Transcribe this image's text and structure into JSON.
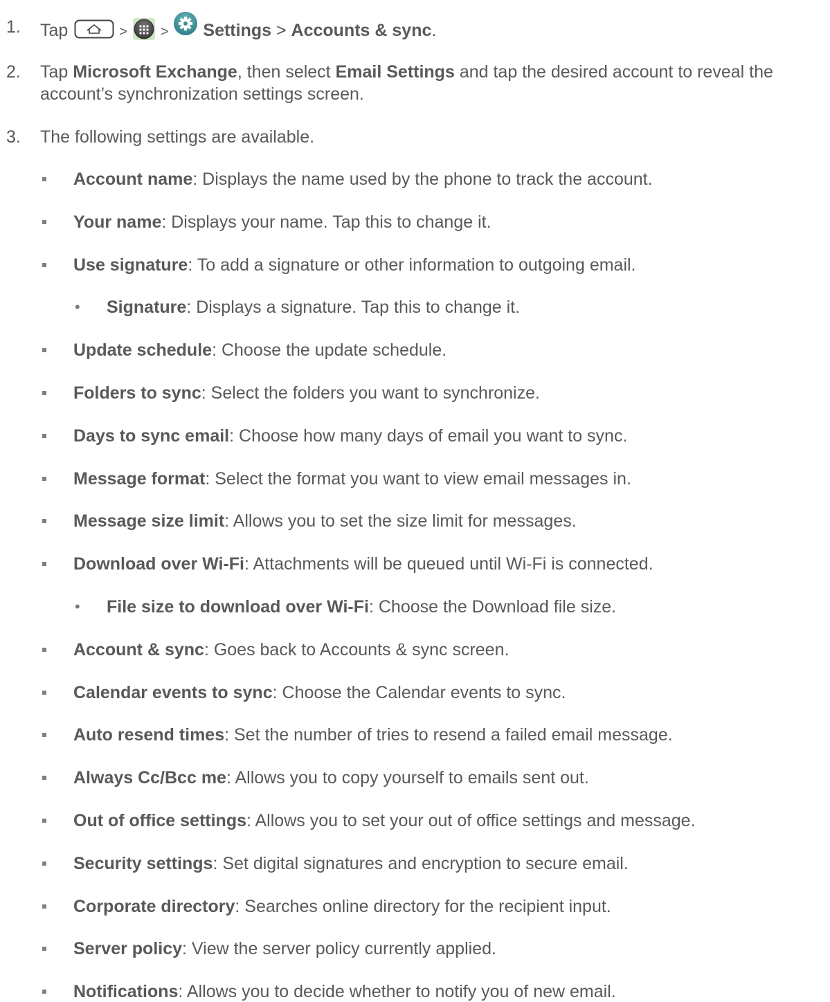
{
  "step1": {
    "number": "1.",
    "tap": "Tap",
    "sep1": ">",
    "sep2": ">",
    "settings": "Settings",
    "sep3": ">",
    "accounts_sync": "Accounts & sync",
    "end": ".",
    "icons": [
      "home-key-icon",
      "apps-icon",
      "settings-gear-icon"
    ]
  },
  "step2": {
    "number": "2.",
    "pre": "Tap",
    "bold1": "Microsoft Exchange",
    "mid": ", then select",
    "bold2": "Email Settings",
    "post": "and tap the desired account to reveal the",
    "line2": "account’s synchronization settings screen."
  },
  "step3": {
    "number": "3.",
    "text": "The following settings are available."
  },
  "settings": [
    {
      "label": "Account name",
      "desc": ": Displays the name used by the phone to track the account.",
      "level": 1
    },
    {
      "label": "Your name",
      "desc": ": Displays your name. Tap this to change it.",
      "level": 1
    },
    {
      "label": "Use signature",
      "desc": ": To add a signature or other information to outgoing email.",
      "level": 1
    },
    {
      "label": "Signature",
      "desc": ": Displays a signature. Tap this to change it.",
      "level": 2
    },
    {
      "label": "Update schedule",
      "desc": ": Choose the update schedule.",
      "level": 1
    },
    {
      "label": "Folders to sync",
      "desc": ": Select the folders you want to synchronize.",
      "level": 1
    },
    {
      "label": "Days to sync email",
      "desc": ": Choose how many days of email you want to sync.",
      "level": 1
    },
    {
      "label": "Message format",
      "desc": ": Select the format you want to view email messages in.",
      "level": 1
    },
    {
      "label": "Message size limit",
      "desc": ": Allows you to set the size limit for messages.",
      "level": 1
    },
    {
      "label": "Download over Wi-Fi",
      "desc": ": Attachments will be queued until Wi-Fi is connected.",
      "level": 1
    },
    {
      "label": "File size to download over Wi-Fi",
      "desc": ": Choose the Download file size.",
      "level": 2
    },
    {
      "label": "Account & sync",
      "desc": ": Goes back to Accounts & sync screen.",
      "level": 1
    },
    {
      "label": "Calendar events to sync",
      "desc": ": Choose the Calendar events to sync.",
      "level": 1
    },
    {
      "label": "Auto resend times",
      "desc": ": Set the number of tries to resend a failed email message.",
      "level": 1
    },
    {
      "label": "Always Cc/Bcc me",
      "desc": ": Allows you to copy yourself to emails sent out.",
      "level": 1
    },
    {
      "label": "Out of office settings",
      "desc": ": Allows you to set your out of office settings and message.",
      "level": 1
    },
    {
      "label": "Security settings",
      "desc": ": Set digital signatures and encryption to secure email.",
      "level": 1
    },
    {
      "label": "Corporate directory",
      "desc": ": Searches online directory for the recipient input.",
      "level": 1
    },
    {
      "label": "Server policy",
      "desc": ": View the server policy currently applied.",
      "level": 1
    },
    {
      "label": "Notifications",
      "desc": ": Allows you to decide whether to notify you of new email.",
      "level": 1
    }
  ],
  "colors": {
    "text": "#595959",
    "bullet": "#808080",
    "icon_teal": "#3e8f96"
  }
}
